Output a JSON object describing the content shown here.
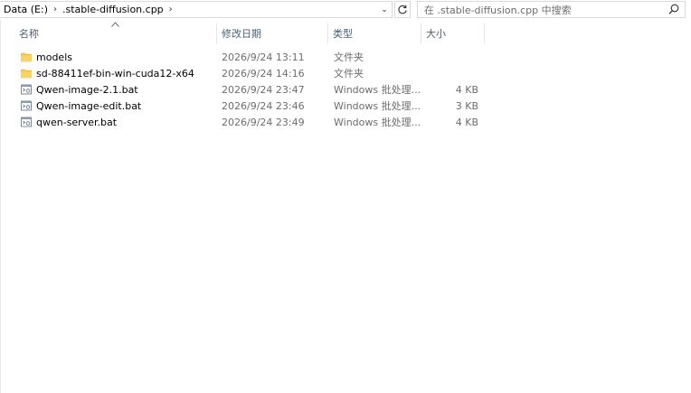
{
  "address": {
    "crumbs": [
      "Data (E:)",
      ".stable-diffusion.cpp"
    ]
  },
  "search": {
    "placeholder": "在 .stable-diffusion.cpp 中搜索"
  },
  "columns": {
    "name": "名称",
    "date": "修改日期",
    "type": "类型",
    "size": "大小"
  },
  "files": [
    {
      "name": "models",
      "date": "2026/9/24 13:11",
      "type": "文件夹",
      "size": "",
      "icon": "folder-icon"
    },
    {
      "name": "sd-88411ef-bin-win-cuda12-x64",
      "date": "2026/9/24 14:16",
      "type": "文件夹",
      "size": "",
      "icon": "folder-icon"
    },
    {
      "name": "Qwen-image-2.1.bat",
      "date": "2026/9/24 23:47",
      "type": "Windows 批处理...",
      "size": "4 KB",
      "icon": "batch-file-icon"
    },
    {
      "name": "Qwen-image-edit.bat",
      "date": "2026/9/24 23:46",
      "type": "Windows 批处理...",
      "size": "3 KB",
      "icon": "batch-file-icon"
    },
    {
      "name": "qwen-server.bat",
      "date": "2026/9/24 23:49",
      "type": "Windows 批处理...",
      "size": "4 KB",
      "icon": "batch-file-icon"
    }
  ],
  "colors": {
    "folder": "#f8c94d",
    "header_text": "#4c607a",
    "meta_text": "#6d6d6d"
  }
}
